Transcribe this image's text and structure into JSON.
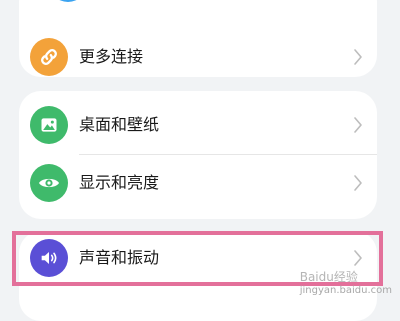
{
  "settings": {
    "items": [
      {
        "label": "更多连接",
        "icon": "link-icon",
        "icon_color": "#f3a23a"
      },
      {
        "label": "桌面和壁纸",
        "icon": "wallpaper-icon",
        "icon_color": "#3fba6b"
      },
      {
        "label": "显示和亮度",
        "icon": "eye-icon",
        "icon_color": "#3fba6b"
      },
      {
        "label": "声音和振动",
        "icon": "speaker-icon",
        "icon_color": "#5a4fd6"
      }
    ],
    "top_partial_icon_color": "#3aa3f0",
    "highlight_color": "#e3709a"
  },
  "watermark": {
    "title": "Baidu经验",
    "url": "jingyan.baidu.com"
  }
}
